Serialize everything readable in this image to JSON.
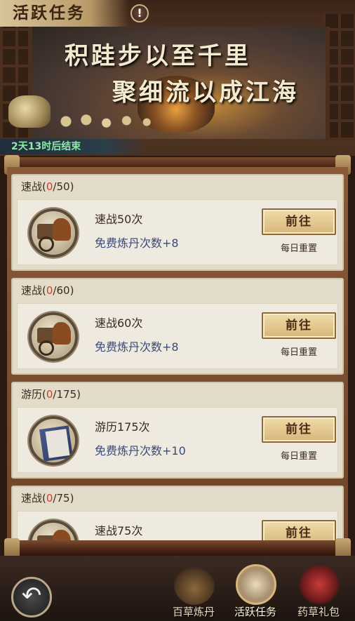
{
  "header": {
    "title": "活跃任务",
    "info_glyph": "!",
    "slogan_line1": "积跬步以至千里",
    "slogan_line2": "聚细流以成江海",
    "timer": "2天13时后结束"
  },
  "tasks": [
    {
      "category": "速战",
      "progress_current": "0",
      "progress_total": "/50)",
      "open_paren": "(",
      "name": "速战50次",
      "reward": "免费炼丹次数+8",
      "button": "前往",
      "reset_note": "每日重置",
      "icon": "horse-carriage-icon"
    },
    {
      "category": "速战",
      "progress_current": "0",
      "progress_total": "/60)",
      "open_paren": "(",
      "name": "速战60次",
      "reward": "免费炼丹次数+8",
      "button": "前往",
      "reset_note": "每日重置",
      "icon": "horse-carriage-icon"
    },
    {
      "category": "游历",
      "progress_current": "0",
      "progress_total": "/175)",
      "open_paren": "(",
      "name": "游历175次",
      "reward": "免费炼丹次数+10",
      "button": "前往",
      "reset_note": "每日重置",
      "icon": "book-icon"
    },
    {
      "category": "速战",
      "progress_current": "0",
      "progress_total": "/75)",
      "open_paren": "(",
      "name": "速战75次",
      "reward": "",
      "button": "前往",
      "reset_note": "",
      "icon": "horse-carriage-icon"
    }
  ],
  "bottom_nav": {
    "back_glyph": "↶",
    "items": [
      {
        "label": "百草炼丹",
        "icon": "cauldron-icon"
      },
      {
        "label": "活跃任务",
        "icon": "scroll-brush-icon"
      },
      {
        "label": "药草礼包",
        "icon": "gift-bag-icon"
      }
    ]
  }
}
